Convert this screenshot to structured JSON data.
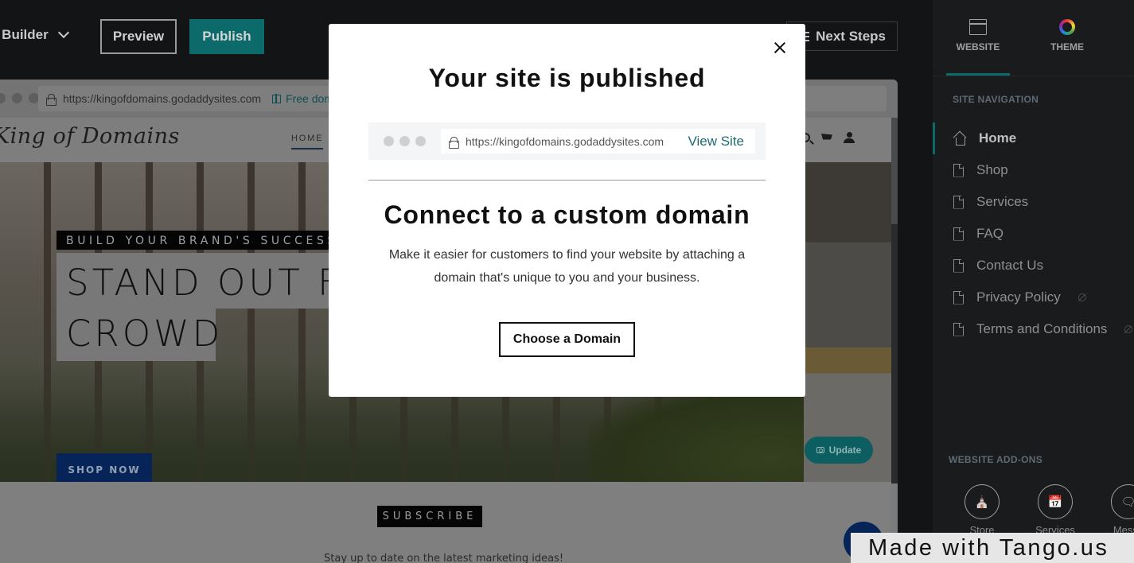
{
  "topbar": {
    "builder_label": "e Builder",
    "preview_label": "Preview",
    "publish_label": "Publish",
    "next_steps_label": "Next Steps"
  },
  "preview": {
    "url": "https://kingofdomains.godaddysites.com",
    "free_domain_label": "Free dom",
    "site_name": "King of Domains",
    "nav_home": "HOME",
    "hero": {
      "tagline": "BUILD YOUR BRAND'S SUCCESS",
      "headline_line1": "STAND OUT FI",
      "headline_line2": "CROWD",
      "cta": "SHOP NOW"
    },
    "update_label": "Update",
    "subscribe_label": "SUBSCRIBE",
    "subscribe_text": "Stay up to date on the latest marketing ideas!"
  },
  "right_panel": {
    "tabs": [
      {
        "label": "WEBSITE",
        "icon": "window-icon",
        "active": true
      },
      {
        "label": "THEME",
        "icon": "color-ring-icon",
        "active": false
      }
    ],
    "site_navigation_title": "SITE NAVIGATION",
    "nav_items": [
      {
        "label": "Home",
        "icon": "home-icon",
        "active": true,
        "hidden": false
      },
      {
        "label": "Shop",
        "icon": "page-icon",
        "active": false,
        "hidden": false
      },
      {
        "label": "Services",
        "icon": "page-icon",
        "active": false,
        "hidden": false
      },
      {
        "label": "FAQ",
        "icon": "page-icon",
        "active": false,
        "hidden": false
      },
      {
        "label": "Contact Us",
        "icon": "page-icon",
        "active": false,
        "hidden": false
      },
      {
        "label": "Privacy Policy",
        "icon": "page-icon",
        "active": false,
        "hidden": true
      },
      {
        "label": "Terms and Conditions",
        "icon": "page-icon",
        "active": false,
        "hidden": true
      }
    ],
    "addons_title": "WEBSITE ADD-ONS",
    "addons": [
      {
        "label": "Store",
        "icon": "storefront-icon"
      },
      {
        "label": "Services",
        "icon": "calendar-icon"
      },
      {
        "label": "Messa",
        "icon": "chat-icon"
      }
    ]
  },
  "modal": {
    "title": "Your site is published",
    "url": "https://kingofdomains.godaddysites.com",
    "view_site_label": "View Site",
    "subtitle": "Connect to a custom domain",
    "description": "Make it easier for customers to find your website by attaching a domain that's unique to you and your business.",
    "cta_label": "Choose a Domain"
  },
  "watermark": "Made with Tango.us",
  "colors": {
    "accent_teal": "#0c6a6b",
    "brand_navy": "#062457",
    "panel_bg": "#1a1b1d",
    "link_teal": "#1f6b72"
  }
}
